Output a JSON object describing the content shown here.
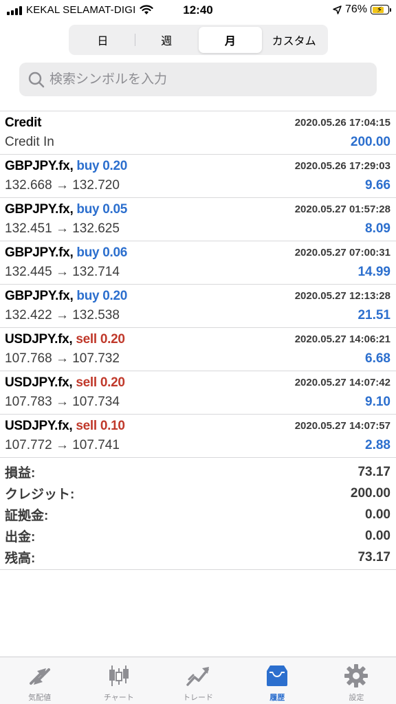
{
  "status_bar": {
    "carrier": "KEKAL SELAMAT-DIGI",
    "time": "12:40",
    "battery_percent": "76%",
    "battery_level": 0.76,
    "battery_color": "#f0c419"
  },
  "period_tabs": [
    {
      "label": "日",
      "selected": false
    },
    {
      "label": "週",
      "selected": false
    },
    {
      "label": "月",
      "selected": true
    },
    {
      "label": "カスタム",
      "selected": false
    }
  ],
  "search": {
    "placeholder": "検索シンボルを入力",
    "value": ""
  },
  "deals": [
    {
      "symbol": "Credit",
      "side": "",
      "volume": "",
      "time": "2020.05.26 17:04:15",
      "prices": "Credit In",
      "profit": "200.00"
    },
    {
      "symbol": "GBPJPY.fx,",
      "side": "buy",
      "volume": "0.20",
      "time": "2020.05.26 17:29:03",
      "prices": "132.668 → 132.720",
      "profit": "9.66"
    },
    {
      "symbol": "GBPJPY.fx,",
      "side": "buy",
      "volume": "0.05",
      "time": "2020.05.27 01:57:28",
      "prices": "132.451 → 132.625",
      "profit": "8.09"
    },
    {
      "symbol": "GBPJPY.fx,",
      "side": "buy",
      "volume": "0.06",
      "time": "2020.05.27 07:00:31",
      "prices": "132.445 → 132.714",
      "profit": "14.99"
    },
    {
      "symbol": "GBPJPY.fx,",
      "side": "buy",
      "volume": "0.20",
      "time": "2020.05.27 12:13:28",
      "prices": "132.422 → 132.538",
      "profit": "21.51"
    },
    {
      "symbol": "USDJPY.fx,",
      "side": "sell",
      "volume": "0.20",
      "time": "2020.05.27 14:06:21",
      "prices": "107.768 → 107.732",
      "profit": "6.68"
    },
    {
      "symbol": "USDJPY.fx,",
      "side": "sell",
      "volume": "0.20",
      "time": "2020.05.27 14:07:42",
      "prices": "107.783 → 107.734",
      "profit": "9.10"
    },
    {
      "symbol": "USDJPY.fx,",
      "side": "sell",
      "volume": "0.10",
      "time": "2020.05.27 14:07:57",
      "prices": "107.772 → 107.741",
      "profit": "2.88"
    }
  ],
  "summary": [
    {
      "label": "損益:",
      "value": "73.17"
    },
    {
      "label": "クレジット:",
      "value": "200.00"
    },
    {
      "label": "証拠金:",
      "value": "0.00"
    },
    {
      "label": "出金:",
      "value": "0.00"
    },
    {
      "label": "残高:",
      "value": "73.17"
    }
  ],
  "tab_bar": [
    {
      "label": "気配値",
      "icon": "quotes-icon",
      "active": false
    },
    {
      "label": "チャート",
      "icon": "chart-icon",
      "active": false
    },
    {
      "label": "トレード",
      "icon": "trade-icon",
      "active": false
    },
    {
      "label": "履歴",
      "icon": "history-icon",
      "active": true
    },
    {
      "label": "設定",
      "icon": "settings-icon",
      "active": false
    }
  ],
  "colors": {
    "buy": "#2c6fce",
    "sell": "#c0392b",
    "profit": "#2c6fce",
    "active_tab": "#2c6fce",
    "inactive_tab": "#8e8e93"
  }
}
